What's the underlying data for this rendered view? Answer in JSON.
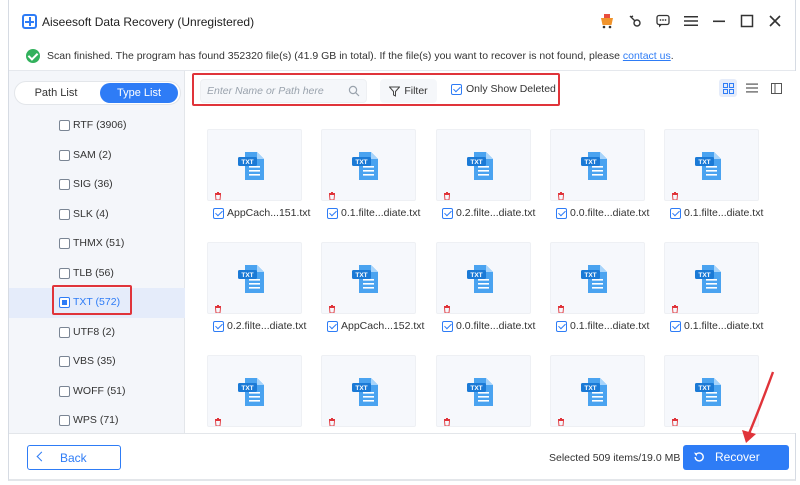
{
  "window": {
    "title": "Aiseesoft Data Recovery (Unregistered)"
  },
  "colors": {
    "accent": "#2e7cf6",
    "success": "#32b15c",
    "highlight": "#e0343a",
    "gift": "#f0932b"
  },
  "infobar": {
    "message": "Scan finished. The program has found 352320 file(s) (41.9 GB in total). If the file(s) you want to recover is not found, please ",
    "link": "contact us",
    "suffix": "."
  },
  "sidebar": {
    "tabs": [
      {
        "label": "Path List"
      },
      {
        "label": "Type List",
        "active": true
      }
    ],
    "types": [
      {
        "label": "RTF (3906)"
      },
      {
        "label": "SAM (2)"
      },
      {
        "label": "SIG (36)"
      },
      {
        "label": "SLK (4)"
      },
      {
        "label": "THMX (51)"
      },
      {
        "label": "TLB (56)"
      },
      {
        "label": "TXT (572)",
        "selected": true
      },
      {
        "label": "UTF8 (2)"
      },
      {
        "label": "VBS (35)"
      },
      {
        "label": "WOFF (51)"
      },
      {
        "label": "WPS (71)"
      }
    ]
  },
  "toolbar": {
    "search_placeholder": "Enter Name or Path here",
    "filter_label": "Filter",
    "only_deleted_label": "Only Show Deleted",
    "only_deleted_checked": true
  },
  "files": [
    {
      "name": "AppCach...151.txt"
    },
    {
      "name": "0.1.filte...diate.txt"
    },
    {
      "name": "0.2.filte...diate.txt"
    },
    {
      "name": "0.0.filte...diate.txt"
    },
    {
      "name": "0.1.filte...diate.txt"
    },
    {
      "name": "0.2.filte...diate.txt"
    },
    {
      "name": "AppCach...152.txt"
    },
    {
      "name": "0.0.filte...diate.txt"
    },
    {
      "name": "0.1.filte...diate.txt"
    },
    {
      "name": "0.1.filte...diate.txt"
    },
    {
      "name": ""
    },
    {
      "name": ""
    },
    {
      "name": ""
    },
    {
      "name": ""
    },
    {
      "name": ""
    }
  ],
  "file_badge": "TXT",
  "footer": {
    "back_label": "Back",
    "selected_info": "Selected 509 items/19.0 MB",
    "recover_label": "Recover"
  }
}
